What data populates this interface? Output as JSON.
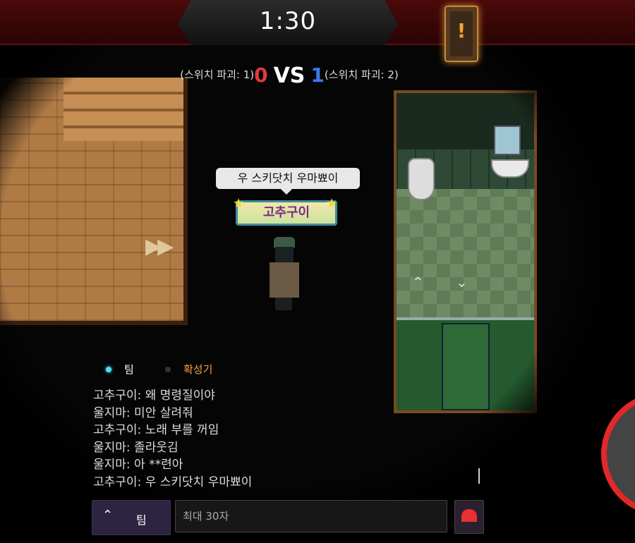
{
  "timer": "1:30",
  "alert_card_icon": "exclamation-card-icon",
  "alert_card_symbol": "!",
  "score": {
    "left_label": "(스위치 파괴: 1)",
    "left_score": "0",
    "vs": "VS",
    "right_score": "1",
    "right_label": "(스위치 파괴: 2)"
  },
  "player": {
    "speech": "우 스키닷치 우마뾰이",
    "name": "고추구이"
  },
  "fast_forward": "▶▶",
  "chat": {
    "channels": [
      {
        "label": "팀",
        "active": true
      },
      {
        "label": "확성기",
        "active": false
      }
    ],
    "messages": [
      "고추구이: 왜 명령질이야",
      "울지마: 미안 살려줘",
      "고추구이: 노래 부를 꺼임",
      "울지마: 졸라웃김",
      "울지마: 아 **련아",
      "고추구이: 우 스키닷치 우마뾰이"
    ],
    "team_button": "팀",
    "team_chevron": "⌃",
    "input_placeholder": "최대 30자"
  },
  "nav": {
    "up": "⌃",
    "down": "⌄"
  },
  "colors": {
    "red_team": "#e23a3a",
    "blue_team": "#3a7af0",
    "accent": "#f2a243"
  }
}
